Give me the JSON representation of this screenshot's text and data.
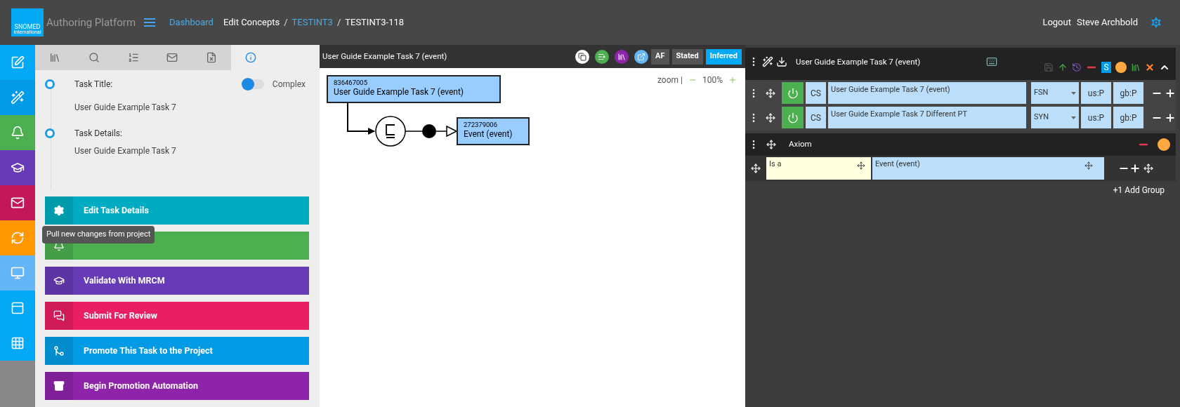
{
  "header": {
    "logo_lines": [
      "SNOMED",
      "International"
    ],
    "app_title": "Authoring Platform",
    "breadcrumbs": [
      {
        "label": "Dashboard",
        "kind": "link"
      },
      {
        "label": "Edit Concepts",
        "kind": "text"
      },
      {
        "label": "TESTINT3",
        "kind": "link"
      },
      {
        "label": "TESTINT3-118",
        "kind": "text"
      }
    ],
    "separator": "/",
    "logout": "Logout",
    "user": "Steve Archbold"
  },
  "nav": [
    {
      "color": "#03a9f4"
    },
    {
      "color": "#039be5"
    },
    {
      "color": "#4caf50"
    },
    {
      "color": "#673ab7"
    },
    {
      "color": "#c2185b"
    },
    {
      "color": "#ff9800",
      "tooltip": "Pull new changes from project"
    },
    {
      "color": "#64b5f6"
    },
    {
      "color": "#03a9f4"
    },
    {
      "color": "#03a9f4"
    }
  ],
  "tabs": [
    {
      "selected": false
    },
    {
      "selected": false
    },
    {
      "selected": false
    },
    {
      "selected": false
    },
    {
      "selected": false
    },
    {
      "selected": true
    }
  ],
  "task": {
    "fields": [
      {
        "label": "Task Title:",
        "value": "User Guide Example Task 7"
      },
      {
        "label": "Task Details:",
        "value": "User Guide Example Task 7"
      }
    ],
    "complex_toggle": {
      "label": "Complex",
      "on": false
    }
  },
  "actions": [
    {
      "label": "Edit Task Details",
      "color": "#00acc1"
    },
    {
      "color": "#4caf50"
    },
    {
      "label": "Validate With MRCM",
      "color": "#673ab7"
    },
    {
      "label": "Submit For Review",
      "color": "#e91e63"
    },
    {
      "label": "Promote This Task to the Project",
      "color": "#039be5"
    },
    {
      "label": "Begin Promotion Automation",
      "color": "#8e24aa"
    }
  ],
  "diagram": {
    "title": "User Guide Example Task 7 (event)",
    "view_buttons": [
      {
        "label": "AF",
        "selected": false
      },
      {
        "label": "Stated",
        "selected": false
      },
      {
        "label": "Inferred",
        "selected": true
      }
    ],
    "zoom_label": "zoom |",
    "zoom_value": "100%",
    "concepts": [
      {
        "id": "836467005",
        "name": "User Guide Example Task 7 (event)"
      },
      {
        "id": "272379006",
        "name": "Event (event)"
      }
    ]
  },
  "editor": {
    "title": "User Guide Example Task 7 (event)",
    "flag": "S",
    "descriptions": [
      {
        "case": "CS",
        "text": "User Guide Example Task 7 (event)",
        "type": "FSN",
        "us": "us:P",
        "gb": "gb:P",
        "active": true
      },
      {
        "case": "CS",
        "text": "User Guide Example Task 7 Different PT",
        "type": "SYN",
        "us": "us:P",
        "gb": "gb:P",
        "active": true
      }
    ],
    "axiom": {
      "title": "Axiom",
      "relationships": [
        {
          "type": "Is a",
          "target": "Event (event)"
        }
      ]
    },
    "add_group": "+1 Add Group"
  }
}
